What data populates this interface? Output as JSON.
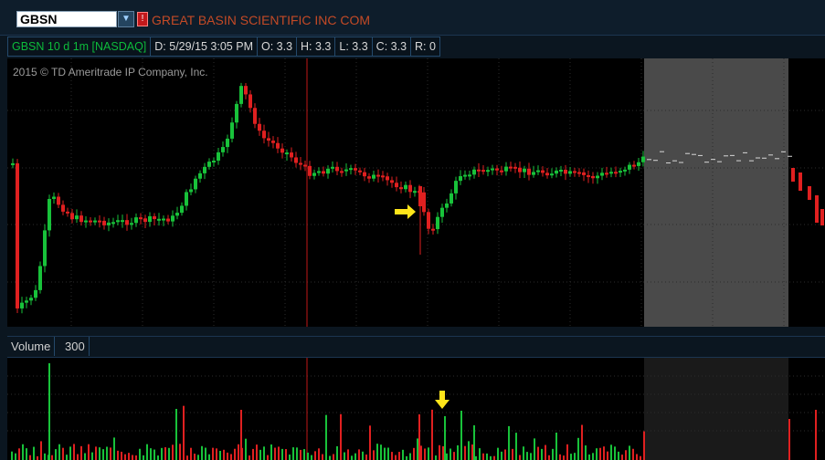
{
  "header": {
    "symbol": "GBSN",
    "company_name": "GREAT BASIN SCIENTIFIC INC COM",
    "flag_label": "!",
    "dropdown_icon": "chevron-down-icon"
  },
  "info_bar": {
    "study": "GBSN 10 d 1m [NASDAQ]",
    "date": "D: 5/29/15 3:05 PM",
    "open": "O: 3.3",
    "high": "H: 3.3",
    "low": "L: 3.3",
    "close": "C: 3.3",
    "range": "R: 0"
  },
  "price_panel": {
    "copyright": "2015 © TD Ameritrade IP Company, Inc."
  },
  "volume_panel": {
    "label": "Volume",
    "value": "300"
  },
  "colors": {
    "up": "#18c23a",
    "down": "#e02020",
    "marker": "#ffe51a",
    "session_shade": "#4a4a4a",
    "grid": "#2c2c2c",
    "cursor_line": "#c01818"
  }
}
